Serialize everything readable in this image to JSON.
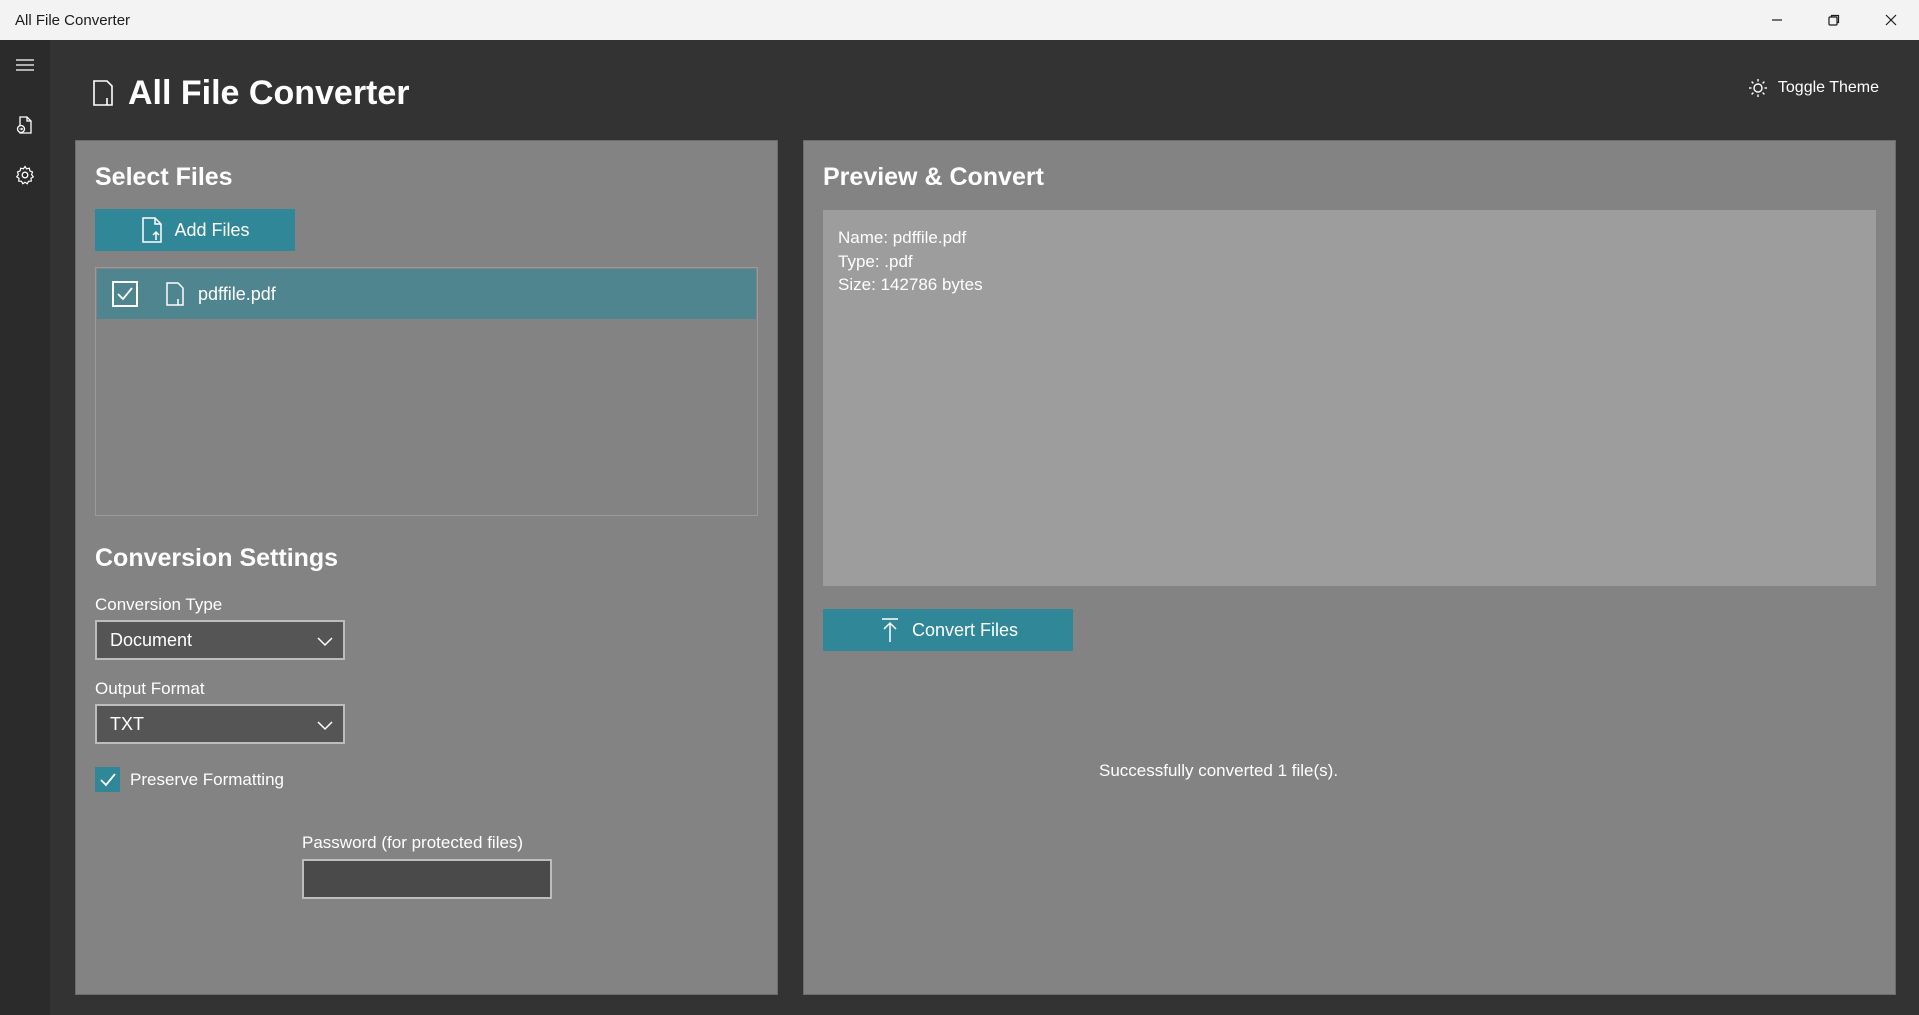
{
  "window": {
    "title": "All File Converter",
    "controls": [
      "minimize",
      "restore",
      "close"
    ]
  },
  "nav": {
    "items": [
      {
        "icon": "hamburger-menu-icon"
      },
      {
        "icon": "file-convert-icon"
      },
      {
        "icon": "gear-icon"
      }
    ]
  },
  "header": {
    "title": "All File Converter",
    "toggle_theme_label": "Toggle Theme"
  },
  "select_files": {
    "title": "Select Files",
    "add_files_label": "Add Files",
    "files": [
      {
        "name": "pdffile.pdf",
        "checked": true
      }
    ]
  },
  "settings": {
    "title": "Conversion Settings",
    "conversion_type_label": "Conversion Type",
    "conversion_type_value": "Document",
    "output_format_label": "Output Format",
    "output_format_value": "TXT",
    "preserve_formatting_label": "Preserve Formatting",
    "preserve_formatting_checked": true,
    "password_label": "Password (for protected files)",
    "password_value": ""
  },
  "preview": {
    "title": "Preview & Convert",
    "lines": [
      "Name: pdffile.pdf",
      "Type: .pdf",
      "Size: 142786 bytes"
    ],
    "convert_label": "Convert Files",
    "status": "Successfully converted 1 file(s)."
  },
  "colors": {
    "accent": "#2f8797",
    "selected_row": "#4e858f",
    "panel": "#838383",
    "background": "#333333"
  }
}
